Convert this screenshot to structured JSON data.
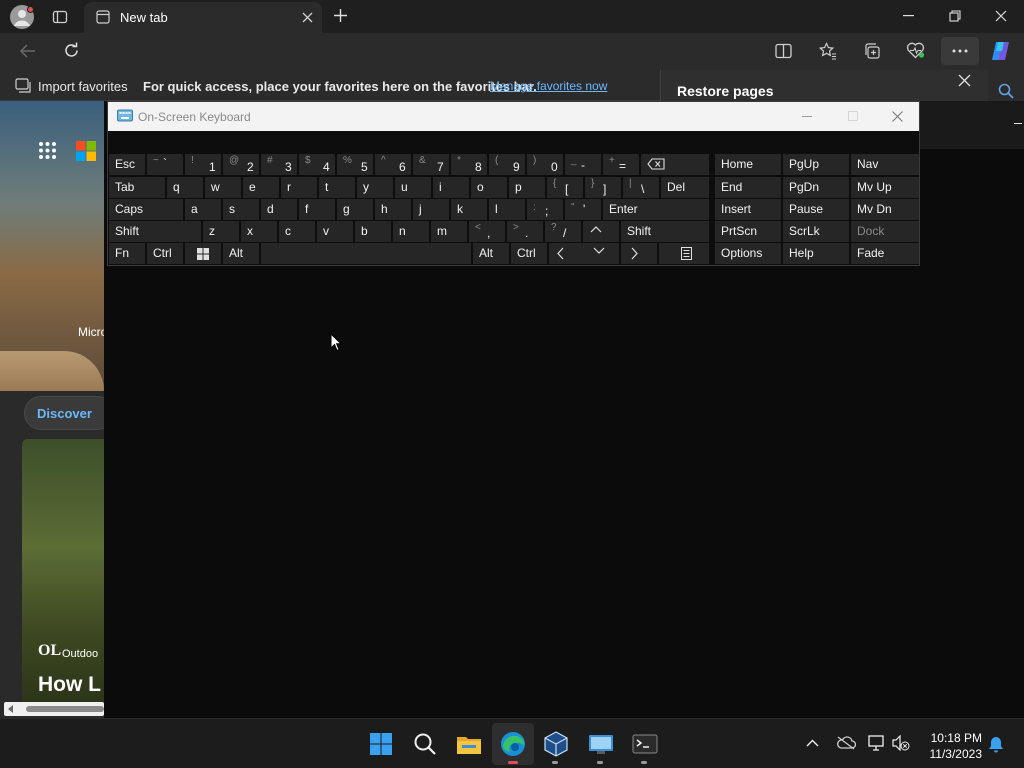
{
  "browser": {
    "tab_title": "New tab",
    "favorites_bar": {
      "import_label": "Import favorites",
      "hint": "For quick access, place your favorites here on the favorites bar.",
      "manage_link": "Manage favorites now"
    },
    "restore_panel": {
      "title": "Restore pages"
    }
  },
  "ntp": {
    "microsoft_label": "Micro",
    "discover_label": "Discover",
    "card_source": "Outdoo",
    "card_headline": "How L",
    "logo_text": "OL"
  },
  "osk": {
    "title": "On-Screen Keyboard",
    "keys": {
      "esc": "Esc",
      "tab": "Tab",
      "caps": "Caps",
      "shift_l": "Shift",
      "fn": "Fn",
      "ctrl_l": "Ctrl",
      "alt_l": "Alt",
      "alt_r": "Alt",
      "ctrl_r": "Ctrl",
      "shift_r": "Shift",
      "enter": "Enter",
      "del": "Del",
      "q": "q",
      "w": "w",
      "e": "e",
      "r": "r",
      "t": "t",
      "y": "y",
      "u": "u",
      "i": "i",
      "o": "o",
      "p": "p",
      "a": "a",
      "s": "s",
      "d": "d",
      "f": "f",
      "g": "g",
      "h": "h",
      "j": "j",
      "k": "k",
      "l": "l",
      "z": "z",
      "x": "x",
      "c": "c",
      "v": "v",
      "b": "b",
      "n": "n",
      "m": "m",
      "n1": "1",
      "n2": "2",
      "n3": "3",
      "n4": "4",
      "n5": "5",
      "n6": "6",
      "n7": "7",
      "n8": "8",
      "n9": "9",
      "n0": "0",
      "s1": "!",
      "s2": "@",
      "s3": "#",
      "s4": "$",
      "s5": "%",
      "s6": "^",
      "s7": "&",
      "s8": "*",
      "s9": "(",
      "s0": ")",
      "tilde_sub": "~",
      "tilde_main": "`",
      "minus_sub": "_",
      "minus_main": "-",
      "plus_sub": "+",
      "plus_main": "=",
      "lbr_sub": "{",
      "lbr_main": "[",
      "rbr_sub": "}",
      "rbr_main": "]",
      "pipe_sub": "|",
      "pipe_main": "\\",
      "colon_sub": ":",
      "colon_main": ";",
      "quote_sub": "\"",
      "quote_main": "'",
      "lt_sub": "<",
      "lt_main": ",",
      "gt_sub": ">",
      "gt_main": ".",
      "q_sub": "?",
      "q_main": "/",
      "home": "Home",
      "pgup": "PgUp",
      "nav": "Nav",
      "end": "End",
      "pgdn": "PgDn",
      "mvup": "Mv Up",
      "insert": "Insert",
      "pause": "Pause",
      "mvdn": "Mv Dn",
      "prtscn": "PrtScn",
      "scrlk": "ScrLk",
      "dock": "Dock",
      "options": "Options",
      "help": "Help",
      "fade": "Fade"
    }
  },
  "taskbar": {
    "time": "10:18 PM",
    "date": "11/3/2023"
  },
  "colors": {
    "accent": "#5fa4e6",
    "link": "#6cb8ff",
    "osk_key": "#262626"
  }
}
